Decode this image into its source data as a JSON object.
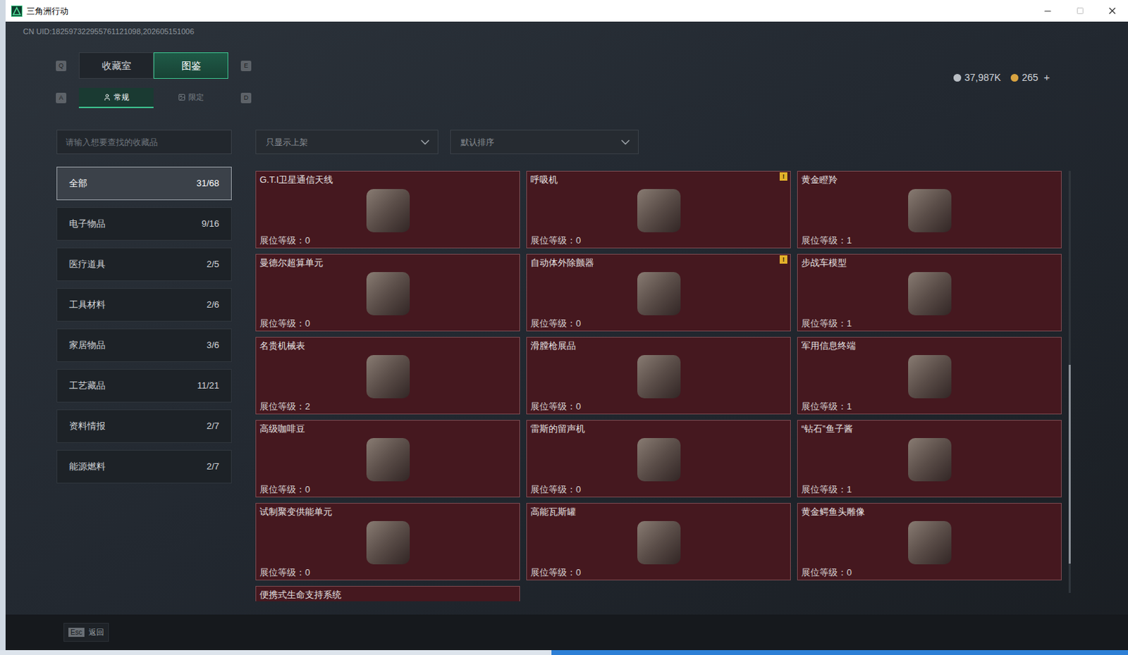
{
  "window": {
    "title": "三角洲行动"
  },
  "uid": "CN UID:182597322955761121098,202605151006",
  "currency": [
    {
      "amount": "37,987K",
      "color": "#b9bec4"
    },
    {
      "amount": "265",
      "color": "#d9a441"
    }
  ],
  "currency_add": "+",
  "tabs": {
    "prev_key": "Q",
    "next_key": "E",
    "items": [
      {
        "label": "收藏室",
        "selected": false
      },
      {
        "label": "图鉴",
        "selected": true
      }
    ]
  },
  "subtabs": {
    "prev_key": "A",
    "next_key": "D",
    "items": [
      {
        "label": "常规",
        "selected": true
      },
      {
        "label": "限定",
        "selected": false
      }
    ]
  },
  "search": {
    "placeholder": "请输入想要查找的收藏品"
  },
  "filters": [
    {
      "label": "只显示上架"
    },
    {
      "label": "默认排序"
    }
  ],
  "categories": [
    {
      "name": "全部",
      "count": "31/68",
      "selected": true
    },
    {
      "name": "电子物品",
      "count": "9/16",
      "selected": false
    },
    {
      "name": "医疗道具",
      "count": "2/5",
      "selected": false
    },
    {
      "name": "工具材料",
      "count": "2/6",
      "selected": false
    },
    {
      "name": "家居物品",
      "count": "3/6",
      "selected": false
    },
    {
      "name": "工艺藏品",
      "count": "11/21",
      "selected": false
    },
    {
      "name": "资料情报",
      "count": "2/7",
      "selected": false
    },
    {
      "name": "能源燃料",
      "count": "2/7",
      "selected": false
    }
  ],
  "level_label": "展位等级：",
  "items": [
    {
      "name": "G.T.I卫星通信天线",
      "level": "0",
      "badge": null
    },
    {
      "name": "呼吸机",
      "level": "0",
      "badge": "!"
    },
    {
      "name": "黄金瞪羚",
      "level": "1",
      "badge": null
    },
    {
      "name": "曼德尔超算单元",
      "level": "0",
      "badge": null
    },
    {
      "name": "自动体外除颤器",
      "level": "0",
      "badge": "!"
    },
    {
      "name": "步战车模型",
      "level": "1",
      "badge": null
    },
    {
      "name": "名贵机械表",
      "level": "2",
      "badge": null
    },
    {
      "name": "滑膛枪展品",
      "level": "0",
      "badge": null
    },
    {
      "name": "军用信息终端",
      "level": "1",
      "badge": null
    },
    {
      "name": "高级咖啡豆",
      "level": "0",
      "badge": null
    },
    {
      "name": "雷斯的留声机",
      "level": "0",
      "badge": null
    },
    {
      "name": "“钻石”鱼子酱",
      "level": "1",
      "badge": null
    },
    {
      "name": "试制聚变供能单元",
      "level": "0",
      "badge": null
    },
    {
      "name": "高能瓦斯罐",
      "level": "0",
      "badge": null
    },
    {
      "name": "黄金鳄鱼头雕像",
      "level": "0",
      "badge": null
    },
    {
      "name": "便携式生命支持系统",
      "level": null,
      "badge": null
    }
  ],
  "scrollbar": {
    "position": 0.46,
    "size": 0.47
  },
  "footer": {
    "key": "Esc",
    "label": "返回"
  }
}
